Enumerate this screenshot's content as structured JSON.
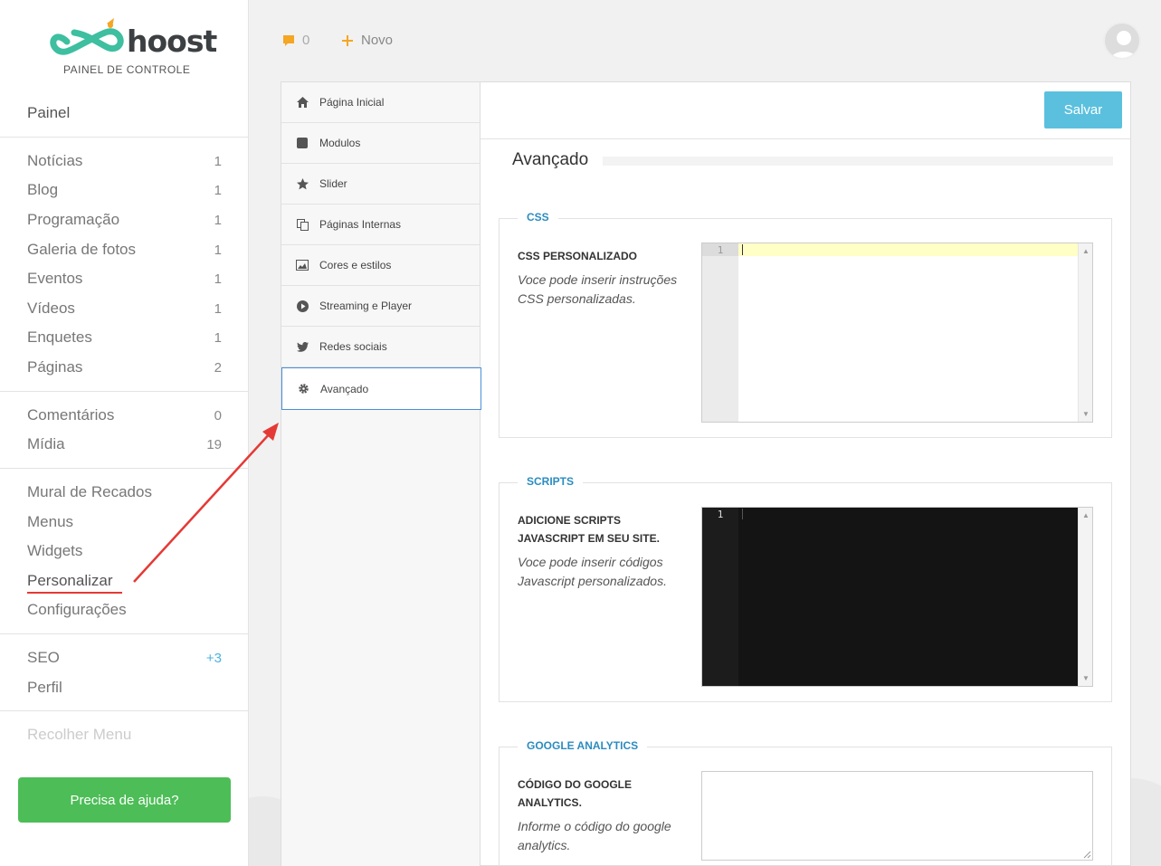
{
  "brand": {
    "name": "hoost",
    "subtitle": "PAINEL DE CONTROLE"
  },
  "sidebar": {
    "painel": "Painel",
    "group1": [
      {
        "label": "Notícias",
        "count": "1"
      },
      {
        "label": "Blog",
        "count": "1"
      },
      {
        "label": "Programação",
        "count": "1"
      },
      {
        "label": "Galeria de fotos",
        "count": "1"
      },
      {
        "label": "Eventos",
        "count": "1"
      },
      {
        "label": "Vídeos",
        "count": "1"
      },
      {
        "label": "Enquetes",
        "count": "1"
      },
      {
        "label": "Páginas",
        "count": "2"
      }
    ],
    "group2": [
      {
        "label": "Comentários",
        "count": "0"
      },
      {
        "label": "Mídia",
        "count": "19"
      }
    ],
    "group3": [
      {
        "label": "Mural de Recados"
      },
      {
        "label": "Menus"
      },
      {
        "label": "Widgets"
      },
      {
        "label": "Personalizar"
      },
      {
        "label": "Configurações"
      }
    ],
    "group4": [
      {
        "label": "SEO",
        "count": "+3"
      },
      {
        "label": "Perfil"
      }
    ],
    "collapse": "Recolher Menu",
    "help_button": "Precisa de ajuda?"
  },
  "topbar": {
    "comments_count": "0",
    "new_label": "Novo"
  },
  "customize_menu": [
    {
      "label": "Página Inicial",
      "icon": "home-icon"
    },
    {
      "label": "Modulos",
      "icon": "square-icon"
    },
    {
      "label": "Slider",
      "icon": "star-icon"
    },
    {
      "label": "Páginas Internas",
      "icon": "copy-icon"
    },
    {
      "label": "Cores e estilos",
      "icon": "image-icon"
    },
    {
      "label": "Streaming e Player",
      "icon": "play-circle-icon"
    },
    {
      "label": "Redes sociais",
      "icon": "twitter-icon"
    },
    {
      "label": "Avançado",
      "icon": "gear-icon"
    }
  ],
  "content": {
    "save_label": "Salvar",
    "section_title": "Avançado",
    "css": {
      "legend": "CSS",
      "label": "CSS PERSONALIZADO",
      "help": "Voce pode inserir instruções CSS personalizadas.",
      "line_number": "1"
    },
    "scripts": {
      "legend": "SCRIPTS",
      "label": "ADICIONE SCRIPTS JAVASCRIPT EM SEU SITE.",
      "help": "Voce pode inserir códigos Javascript personalizados.",
      "line_number": "1"
    },
    "analytics": {
      "legend": "GOOGLE ANALYTICS",
      "label": "CÓDIGO DO GOOGLE ANALYTICS.",
      "help": "Informe o código do google analytics."
    }
  },
  "colors": {
    "accent": "#5bc0de",
    "brand_green": "#4dbd57",
    "legend_blue": "#2b8cbf",
    "annotation_red": "#e53935"
  }
}
